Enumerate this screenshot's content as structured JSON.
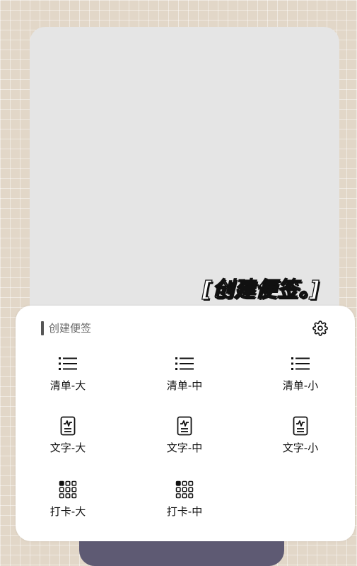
{
  "overlay_title": "[创建便签。]",
  "sheet": {
    "title": "创建便签",
    "settings_icon": "gear-icon",
    "items": [
      {
        "label": "清单-大",
        "icon": "list-icon"
      },
      {
        "label": "清单-中",
        "icon": "list-icon"
      },
      {
        "label": "清单-小",
        "icon": "list-icon"
      },
      {
        "label": "文字-大",
        "icon": "text-document-icon"
      },
      {
        "label": "文字-中",
        "icon": "text-document-icon"
      },
      {
        "label": "文字-小",
        "icon": "text-document-icon"
      },
      {
        "label": "打卡-大",
        "icon": "grid-dots-icon"
      },
      {
        "label": "打卡-中",
        "icon": "grid-dots-icon"
      }
    ]
  },
  "colors": {
    "background": "#e2d7c8",
    "preview_card": "#e5e5e5",
    "sheet": "#ffffff",
    "dock": "#5e5a73",
    "accent_bar": "#555555"
  }
}
